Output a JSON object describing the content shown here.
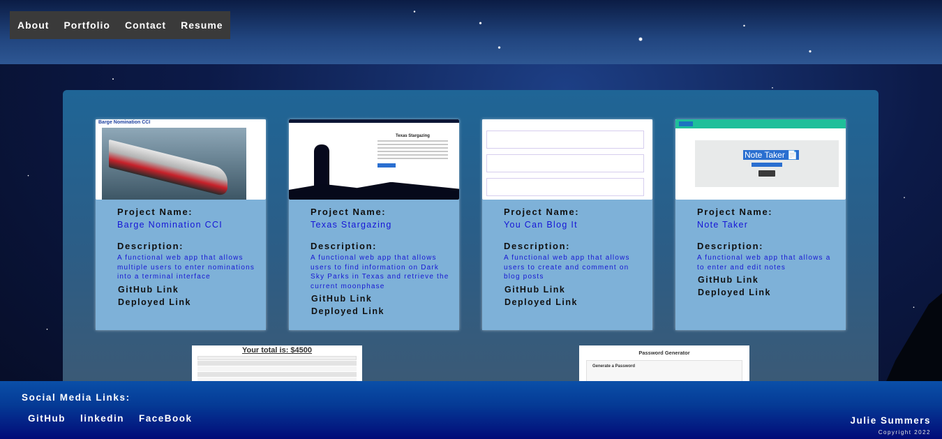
{
  "nav": {
    "items": [
      "About",
      "Portfolio",
      "Contact",
      "Resume"
    ]
  },
  "labels": {
    "project_name": "Project Name:",
    "description": "Description:"
  },
  "projects": [
    {
      "name": "Barge Nomination CCI",
      "description": "A functional web app that allows multiple users to enter nominations into a terminal interface",
      "github": "GitHub Link",
      "deployed": "Deployed Link",
      "thumb_title": "Barge Nomination CCI"
    },
    {
      "name": "Texas Stargazing",
      "description": "A functional web app that allows users to find information on Dark Sky Parks in Texas and retrieve the current moonphase",
      "github": "GitHub Link",
      "deployed": "Deployed Link",
      "thumb_title": "Texas Stargazing"
    },
    {
      "name": "You Can Blog It",
      "description": "A functional web app that allows users to create and comment on blog posts",
      "github": "GitHub Link",
      "deployed": "Deployed Link"
    },
    {
      "name": "Note Taker",
      "description": "A functional web app that allows a to enter and edit notes",
      "github": "GitHub Link",
      "deployed": "Deployed Link",
      "thumb_title": "Note Taker 📄"
    }
  ],
  "bottom_cards": [
    {
      "thumb_title": "Your total is: $4500"
    },
    {
      "thumb_title": "Password Generator",
      "thumb_subtitle": "Generate a Password"
    }
  ],
  "footer": {
    "title": "Social Media Links:",
    "socials": [
      "GitHub",
      "linkedin",
      "FaceBook"
    ],
    "name": "Julie Summers",
    "copyright": "Copyright 2022"
  }
}
